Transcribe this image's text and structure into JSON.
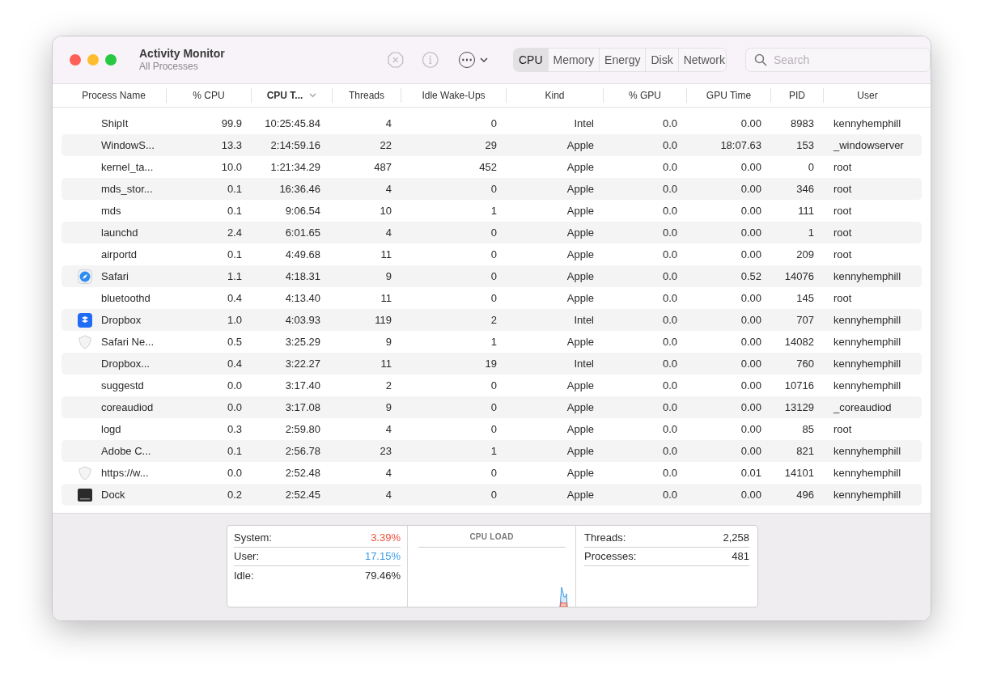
{
  "window": {
    "title": "Activity Monitor",
    "subtitle": "All Processes"
  },
  "toolbar": {
    "more_menu_label": "⋯"
  },
  "tabs": [
    {
      "label": "CPU",
      "selected": true
    },
    {
      "label": "Memory",
      "selected": false
    },
    {
      "label": "Energy",
      "selected": false
    },
    {
      "label": "Disk",
      "selected": false
    },
    {
      "label": "Network",
      "selected": false
    }
  ],
  "search": {
    "placeholder": "Search"
  },
  "table": {
    "columns": [
      {
        "label": "Process Name",
        "sorted": false
      },
      {
        "label": "% CPU",
        "sorted": false
      },
      {
        "label": "CPU T...",
        "sorted": true
      },
      {
        "label": "Threads",
        "sorted": false
      },
      {
        "label": "Idle Wake-Ups",
        "sorted": false
      },
      {
        "label": "Kind",
        "sorted": false
      },
      {
        "label": "% GPU",
        "sorted": false
      },
      {
        "label": "GPU Time",
        "sorted": false
      },
      {
        "label": "PID",
        "sorted": false
      },
      {
        "label": "User",
        "sorted": false
      }
    ],
    "rows": [
      {
        "kind": "none",
        "cells": [
          "ShipIt",
          "99.9",
          "10:25:45.84",
          "4",
          "0",
          "Intel",
          "0.0",
          "0.00",
          "8983",
          "kennyhemphill"
        ]
      },
      {
        "kind": "none",
        "cells": [
          "WindowS...",
          "13.3",
          "2:14:59.16",
          "22",
          "29",
          "Apple",
          "0.0",
          "18:07.63",
          "153",
          "_windowserver"
        ]
      },
      {
        "kind": "none",
        "cells": [
          "kernel_ta...",
          "10.0",
          "1:21:34.29",
          "487",
          "452",
          "Apple",
          "0.0",
          "0.00",
          "0",
          "root"
        ]
      },
      {
        "kind": "none",
        "cells": [
          "mds_stor...",
          "0.1",
          "16:36.46",
          "4",
          "0",
          "Apple",
          "0.0",
          "0.00",
          "346",
          "root"
        ]
      },
      {
        "kind": "none",
        "cells": [
          "mds",
          "0.1",
          "9:06.54",
          "10",
          "1",
          "Apple",
          "0.0",
          "0.00",
          "111",
          "root"
        ]
      },
      {
        "kind": "none",
        "cells": [
          "launchd",
          "2.4",
          "6:01.65",
          "4",
          "0",
          "Apple",
          "0.0",
          "0.00",
          "1",
          "root"
        ]
      },
      {
        "kind": "none",
        "cells": [
          "airportd",
          "0.1",
          "4:49.68",
          "11",
          "0",
          "Apple",
          "0.0",
          "0.00",
          "209",
          "root"
        ]
      },
      {
        "kind": "app",
        "cells": [
          "Safari",
          "1.1",
          "4:18.31",
          "9",
          "0",
          "Apple",
          "0.0",
          "0.52",
          "14076",
          "kennyhemphill"
        ]
      },
      {
        "kind": "none",
        "cells": [
          "bluetoothd",
          "0.4",
          "4:13.40",
          "11",
          "0",
          "Apple",
          "0.0",
          "0.00",
          "145",
          "root"
        ]
      },
      {
        "kind": "app",
        "cells": [
          "Dropbox",
          "1.0",
          "4:03.93",
          "119",
          "2",
          "Intel",
          "0.0",
          "0.00",
          "707",
          "kennyhemphill"
        ]
      },
      {
        "kind": "helper",
        "cells": [
          "Safari Ne...",
          "0.5",
          "3:25.29",
          "9",
          "1",
          "Apple",
          "0.0",
          "0.00",
          "14082",
          "kennyhemphill"
        ]
      },
      {
        "kind": "none",
        "cells": [
          "Dropbox...",
          "0.4",
          "3:22.27",
          "11",
          "19",
          "Intel",
          "0.0",
          "0.00",
          "760",
          "kennyhemphill"
        ]
      },
      {
        "kind": "none",
        "cells": [
          "suggestd",
          "0.0",
          "3:17.40",
          "2",
          "0",
          "Apple",
          "0.0",
          "0.00",
          "10716",
          "kennyhemphill"
        ]
      },
      {
        "kind": "none",
        "cells": [
          "coreaudiod",
          "0.0",
          "3:17.08",
          "9",
          "0",
          "Apple",
          "0.0",
          "0.00",
          "13129",
          "_coreaudiod"
        ]
      },
      {
        "kind": "none",
        "cells": [
          "logd",
          "0.3",
          "2:59.80",
          "4",
          "0",
          "Apple",
          "0.0",
          "0.00",
          "85",
          "root"
        ]
      },
      {
        "kind": "none",
        "cells": [
          "Adobe C...",
          "0.1",
          "2:56.78",
          "23",
          "1",
          "Apple",
          "0.0",
          "0.00",
          "821",
          "kennyhemphill"
        ]
      },
      {
        "kind": "helper",
        "cells": [
          "https://w...",
          "0.0",
          "2:52.48",
          "4",
          "0",
          "Apple",
          "0.0",
          "0.01",
          "14101",
          "kennyhemphill"
        ]
      },
      {
        "kind": "app",
        "cells": [
          "Dock",
          "0.2",
          "2:52.45",
          "4",
          "0",
          "Apple",
          "0.0",
          "0.00",
          "496",
          "kennyhemphill"
        ]
      }
    ]
  },
  "summary": {
    "load": [
      {
        "label": "System:",
        "value": "3.39%",
        "color": "#f0503c"
      },
      {
        "label": "User:",
        "value": "17.15%",
        "color": "#3a9be8"
      },
      {
        "label": "Idle:",
        "value": "79.46%"
      }
    ],
    "chart_title": "CPU LOAD",
    "counts": [
      {
        "label": "Threads:",
        "value": "2,258"
      },
      {
        "label": "Processes:",
        "value": "481"
      }
    ]
  }
}
